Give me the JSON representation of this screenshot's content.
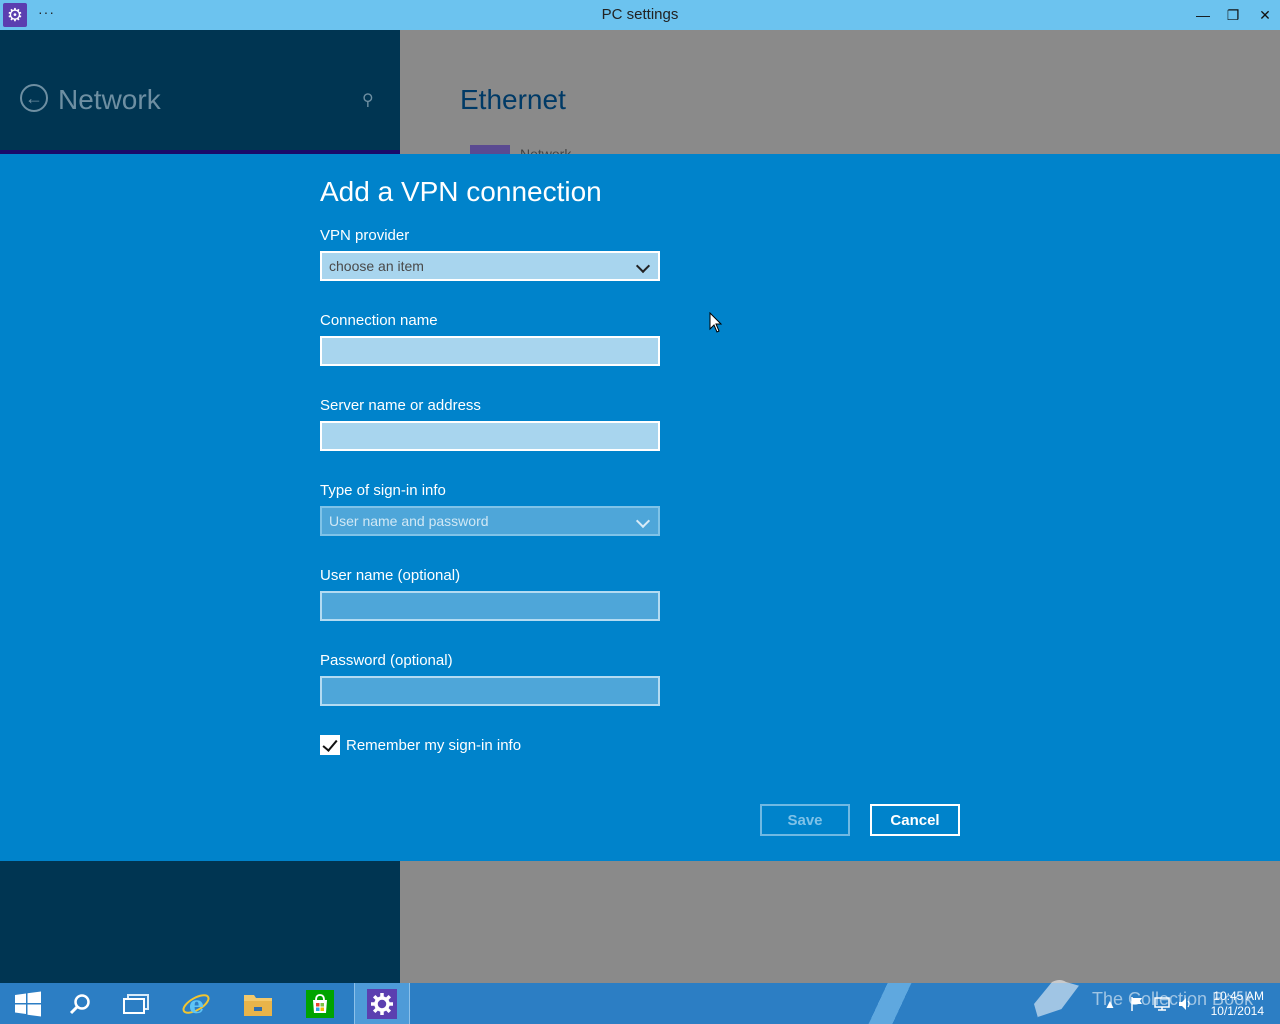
{
  "window": {
    "title": "PC settings",
    "menu_glyph": "···",
    "controls": {
      "minimize": "—",
      "restore": "❐",
      "close": "✕"
    }
  },
  "background": {
    "left_title": "Network",
    "right_title": "Ethernet",
    "right_item_label": "Network"
  },
  "dialog": {
    "title": "Add a VPN connection",
    "vpn_provider": {
      "label": "VPN provider",
      "value": "choose an item"
    },
    "connection_name": {
      "label": "Connection name",
      "value": ""
    },
    "server": {
      "label": "Server name or address",
      "value": ""
    },
    "signin_type": {
      "label": "Type of sign-in info",
      "value": "User name and password"
    },
    "username": {
      "label": "User name (optional)",
      "value": ""
    },
    "password": {
      "label": "Password (optional)",
      "value": ""
    },
    "remember": {
      "label": "Remember my sign-in info",
      "checked": true
    },
    "save_label": "Save",
    "cancel_label": "Cancel"
  },
  "taskbar": {
    "items": [
      "start-icon",
      "search-icon",
      "task-view-icon",
      "internet-explorer-icon",
      "file-explorer-icon",
      "store-icon",
      "pc-settings-icon"
    ],
    "time": "10:45 AM",
    "date": "10/1/2014",
    "watermark": "The Collection Book"
  },
  "colors": {
    "dialog_bg": "#0083cb",
    "titlebar_bg": "#6cc3ef",
    "left_pane_bg": "#003552",
    "taskbar_bg": "#2c7ec4"
  }
}
